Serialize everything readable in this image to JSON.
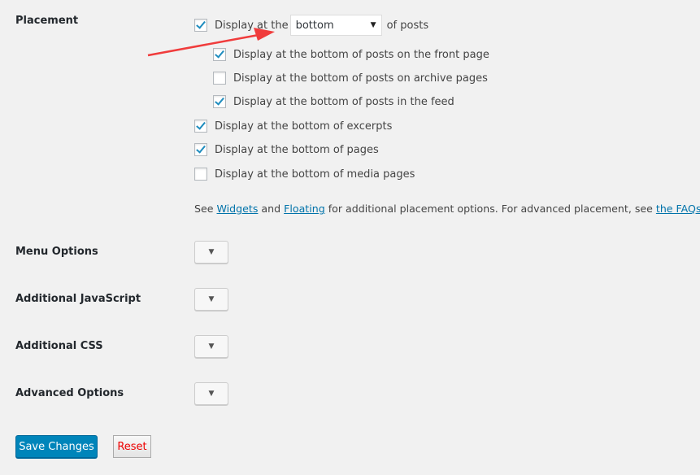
{
  "placement": {
    "label": "Placement",
    "main": {
      "prefix": "Display at the",
      "select_value": "bottom",
      "suffix": "of posts",
      "checked": true
    },
    "sub_options": [
      {
        "label": "Display at the bottom of posts on the front page",
        "checked": true
      },
      {
        "label": "Display at the bottom of posts on archive pages",
        "checked": false
      },
      {
        "label": "Display at the bottom of posts in the feed",
        "checked": true
      }
    ],
    "options": [
      {
        "label": "Display at the bottom of excerpts",
        "checked": true
      },
      {
        "label": "Display at the bottom of pages",
        "checked": true
      },
      {
        "label": "Display at the bottom of media pages",
        "checked": false
      }
    ],
    "help": {
      "t1": "See ",
      "link1": "Widgets",
      "t2": " and ",
      "link2": "Floating",
      "t3": " for additional placement options. For advanced placement, see ",
      "link3": "the FAQs",
      "t4": "."
    }
  },
  "sections": [
    {
      "label": "Menu Options"
    },
    {
      "label": "Additional JavaScript"
    },
    {
      "label": "Additional CSS"
    },
    {
      "label": "Advanced Options"
    }
  ],
  "toggle_glyph": "▼",
  "select_glyph": "▼",
  "buttons": {
    "save": "Save Changes",
    "reset": "Reset"
  },
  "colors": {
    "primary": "#0085ba",
    "checkmark": "#1e8cbe",
    "reset_text": "#ee0000",
    "annotation_arrow": "#f03c3c"
  }
}
